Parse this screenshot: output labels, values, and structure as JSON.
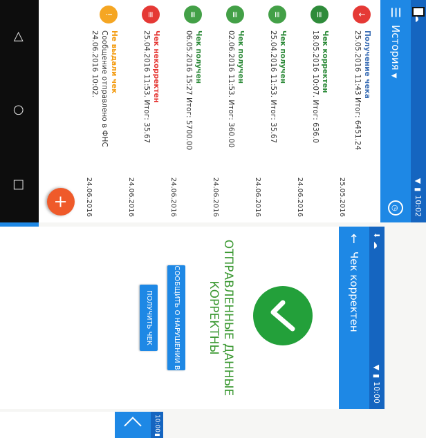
{
  "history": {
    "status_time": "10:02",
    "title": "История",
    "items": [
      {
        "title": "Получение чека",
        "line1": "25.05.2016 11:43  Итог: 6451.24",
        "line2": "",
        "date": "25.05.2016",
        "color": "#e53935",
        "title_color": "#3c6fb5",
        "icon": "↓"
      },
      {
        "title": "Чек корректен",
        "line1": "18.05.2016 10:07.  Итог: 636.0",
        "line2": "",
        "date": "24.06.2016",
        "color": "#2e8b3a",
        "title_color": "#2e8b3a",
        "icon": "≡"
      },
      {
        "title": "Чек получен",
        "line1": "25.04.2016 11:53.  Итог: 35.67",
        "line2": "",
        "date": "24.06.2016",
        "color": "#43a047",
        "title_color": "#2e8b3a",
        "icon": "≡"
      },
      {
        "title": "Чек получен",
        "line1": "02.06.2016 11:53.  Итог: 360.00",
        "line2": "",
        "date": "24.06.2016",
        "color": "#43a047",
        "title_color": "#2e8b3a",
        "icon": "≡"
      },
      {
        "title": "Чек получен",
        "line1": "06.05.2016 15:27  Итог: 5700.00",
        "line2": "",
        "date": "24.06.2016",
        "color": "#43a047",
        "title_color": "#2e8b3a",
        "icon": "≡"
      },
      {
        "title": "Чек некорректен",
        "line1": "25.04.2016 11:53.  Итог: 35.67",
        "line2": "",
        "date": "24.06.2016",
        "color": "#e53935",
        "title_color": "#e53935",
        "icon": "≡"
      },
      {
        "title": "Не выдали чек",
        "line1": "Сообщение отправлено в ФНС",
        "line2": "24.06.2016 10:02.",
        "date": "24.06.2016",
        "color": "#f5a623",
        "title_color": "#f39c12",
        "icon": "!"
      }
    ],
    "fab_label": "+"
  },
  "check": {
    "status_time": "10:00",
    "title": "Чек корректен",
    "message": "ОТПРАВЛЕННЫЕ ДАННЫЕ КОРРЕКТНЫ",
    "report_button": "СООБЩИТЬ О НАРУШЕНИИ В ФНС",
    "get_button": "ПОЛУЧИТЬ ЧЕК"
  },
  "partial": {
    "status_time": "10:00"
  },
  "colors": {
    "primary": "#1e88e5",
    "primary_dark": "#1565c0",
    "success": "#23a03a",
    "fab": "#ef5a2a"
  }
}
